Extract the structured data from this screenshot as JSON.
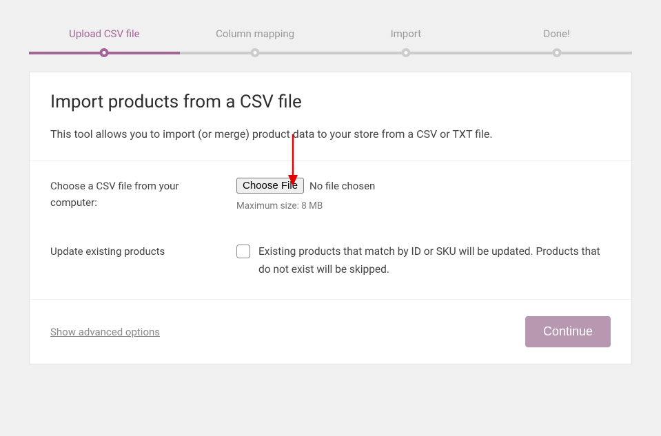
{
  "stepper": {
    "steps": [
      {
        "label": "Upload CSV file",
        "active": true
      },
      {
        "label": "Column mapping",
        "active": false
      },
      {
        "label": "Import",
        "active": false
      },
      {
        "label": "Done!",
        "active": false
      }
    ]
  },
  "header": {
    "title": "Import products from a CSV file",
    "description": "This tool allows you to import (or merge) product data to your store from a CSV or TXT file."
  },
  "form": {
    "file_row": {
      "label": "Choose a CSV file from your computer:",
      "button": "Choose File",
      "status": "No file chosen",
      "hint": "Maximum size: 8 MB"
    },
    "update_row": {
      "label": "Update existing products",
      "checkbox_text": "Existing products that match by ID or SKU will be updated. Products that do not exist will be skipped."
    }
  },
  "footer": {
    "advanced": "Show advanced options",
    "continue": "Continue"
  },
  "annotation": {
    "arrow_color": "#e40000"
  }
}
